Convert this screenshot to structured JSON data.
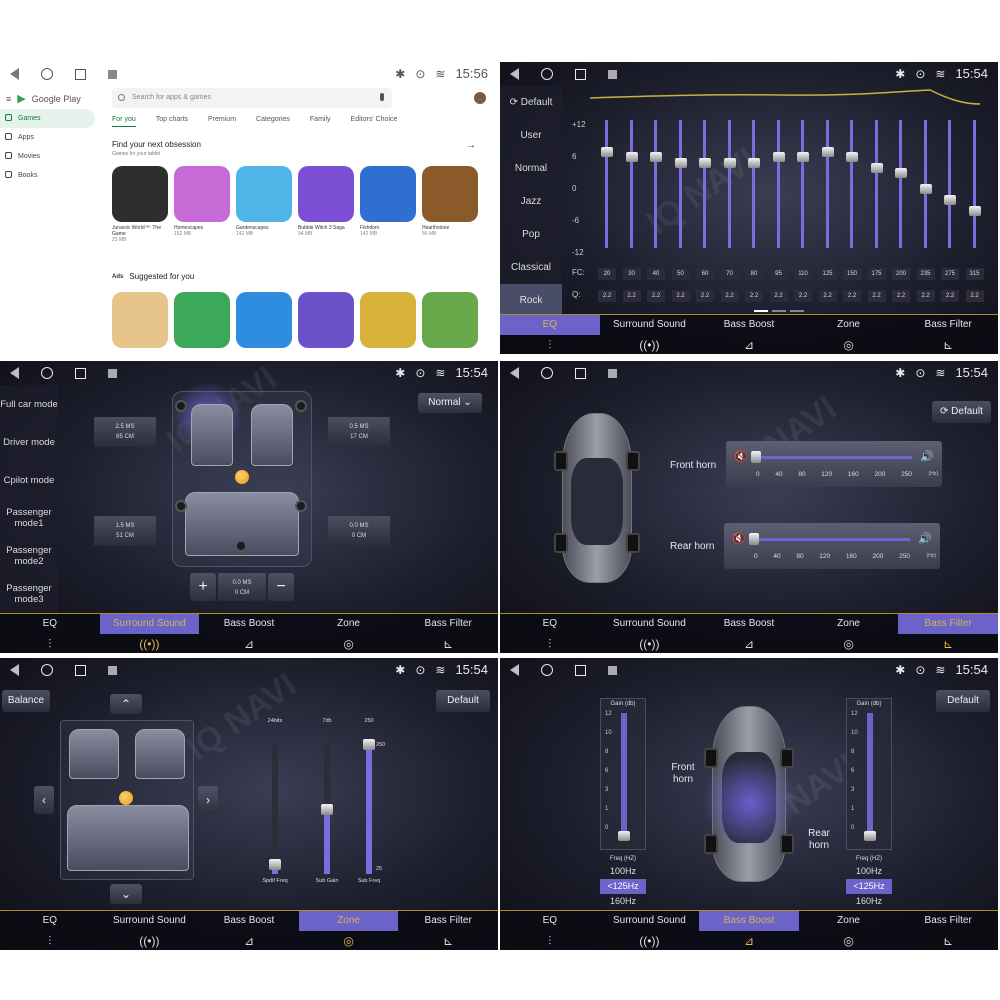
{
  "clock": {
    "p1": "15:56",
    "p2": "15:54",
    "p3": "15:54",
    "p4": "15:54",
    "p5": "15:54",
    "p6": "15:54"
  },
  "tabs": [
    "EQ",
    "Surround Sound",
    "Bass Boost",
    "Zone",
    "Bass Filter"
  ],
  "tab_icons": [
    "eq-sliders-icon",
    "surround-icon",
    "bass-boost-icon",
    "zone-icon",
    "bass-filter-icon"
  ],
  "accent": "#6b63c7",
  "highlight": "#e8b84a",
  "play": {
    "brand": "Google Play",
    "side": [
      "Games",
      "Apps",
      "Movies",
      "Books"
    ],
    "search_placeholder": "Search for apps & games",
    "tabs": [
      "For you",
      "Top charts",
      "Premium",
      "Categories",
      "Family",
      "Editors' Choice"
    ],
    "section1_title": "Find your next obsession",
    "section1_sub": "Games for your tablet",
    "apps": [
      {
        "name": "Jurassic World™: The Game",
        "size": "23 MB",
        "color": "#2c2f2c"
      },
      {
        "name": "Homescapes",
        "size": "152 MB",
        "color": "#c66ad6"
      },
      {
        "name": "Gardenscapes",
        "size": "142 MB",
        "color": "#4fb4e8"
      },
      {
        "name": "Bubble Witch 3 Saga",
        "size": "94 MB",
        "color": "#7a4fd4"
      },
      {
        "name": "Fishdom",
        "size": "142 MB",
        "color": "#2f6fd2"
      },
      {
        "name": "Hearthstone",
        "size": "56 MB",
        "color": "#8a5a2a"
      }
    ],
    "ads": "Ads",
    "section2_title": "Suggested for you",
    "suggested_colors": [
      "#e6c48a",
      "#3ba85a",
      "#2f8de0",
      "#6a52c8",
      "#d8b23a",
      "#68a84a"
    ]
  },
  "eq": {
    "presets": [
      "Default",
      "User",
      "Normal",
      "Jazz",
      "Pop",
      "Classical",
      "Rock"
    ],
    "selected": "Rock",
    "scale": [
      "+12",
      "6",
      "0",
      "-6",
      "-12"
    ],
    "fc_label": "FC:",
    "q_label": "Q:",
    "bands": [
      {
        "fc": "20",
        "q": "2.2",
        "gain": 6
      },
      {
        "fc": "30",
        "q": "2.2",
        "gain": 5
      },
      {
        "fc": "40",
        "q": "2.2",
        "gain": 5
      },
      {
        "fc": "50",
        "q": "2.2",
        "gain": 4
      },
      {
        "fc": "60",
        "q": "2.2",
        "gain": 4
      },
      {
        "fc": "70",
        "q": "2.2",
        "gain": 4
      },
      {
        "fc": "80",
        "q": "2.2",
        "gain": 4
      },
      {
        "fc": "95",
        "q": "2.2",
        "gain": 5
      },
      {
        "fc": "110",
        "q": "2.2",
        "gain": 5
      },
      {
        "fc": "125",
        "q": "2.2",
        "gain": 6
      },
      {
        "fc": "150",
        "q": "2.2",
        "gain": 5
      },
      {
        "fc": "175",
        "q": "2.2",
        "gain": 3
      },
      {
        "fc": "200",
        "q": "2.2",
        "gain": 2
      },
      {
        "fc": "235",
        "q": "2.2",
        "gain": -1
      },
      {
        "fc": "275",
        "q": "2.2",
        "gain": -3
      },
      {
        "fc": "315",
        "q": "2.2",
        "gain": -5
      }
    ]
  },
  "surround": {
    "modes": [
      "Full car mode",
      "Driver mode",
      "Cpilot mode",
      "Passenger mode1",
      "Passenger mode2",
      "Passenger mode3"
    ],
    "preset": "Normal",
    "delays": {
      "fl": [
        "2.5 MS",
        "85 CM"
      ],
      "fr": [
        "0.5 MS",
        "17 CM"
      ],
      "rl": [
        "1.5 MS",
        "51 CM"
      ],
      "rr": [
        "0.0 MS",
        "0 CM"
      ],
      "center": [
        "0.0 MS",
        "0 CM"
      ]
    },
    "plus": "+",
    "minus": "−"
  },
  "horn": {
    "default": "Default",
    "front": "Front horn",
    "rear": "Rear horn",
    "ticks": [
      "0",
      "40",
      "80",
      "120",
      "160",
      "200",
      "250"
    ],
    "unit": "(Hz)",
    "front_value": 0,
    "rear_value": 0
  },
  "zone": {
    "balance": "Balance",
    "default": "Default",
    "sliders": [
      {
        "top": "24bits",
        "label": "Spdif Freq",
        "level": 0.08
      },
      {
        "top": "7db",
        "label": "Sub Gain",
        "level": 0.5
      },
      {
        "top": "250",
        "label": "Sub Freq",
        "level": 1.0,
        "bottom": "25"
      }
    ]
  },
  "bass": {
    "default": "Default",
    "gain_title": "Gain (db)",
    "gain_scale": [
      "12",
      "10",
      "8",
      "6",
      "3",
      "1",
      "0"
    ],
    "freq_title": "Freq (HZ)",
    "freqs": [
      "100Hz",
      "<125Hz",
      "160Hz"
    ],
    "selected": "<125Hz",
    "front": "Front horn",
    "rear": "Rear horn"
  },
  "active_tab": {
    "p2": 0,
    "p3": 1,
    "p4": 4,
    "p5": 3,
    "p6": 2
  }
}
